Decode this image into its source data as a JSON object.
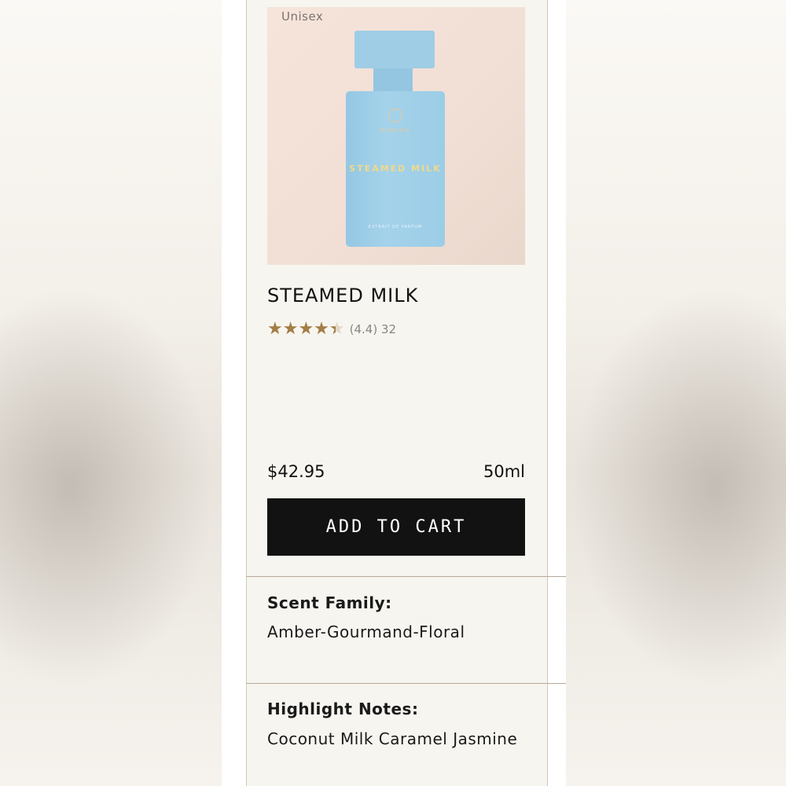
{
  "product": {
    "tag": "Unisex",
    "image": {
      "brand": "DAKCHA",
      "bottle_label": "STEAMED MILK",
      "bottle_sub": "EXTRAIT DE PARFUM"
    },
    "title": "STEAMED MILK",
    "rating": {
      "value": 4.4,
      "max": 5,
      "stars_glyph": "★★★★★",
      "text": "(4.4) 32"
    },
    "price": "$42.95",
    "size": "50ml",
    "add_to_cart_label": "ADD TO CART"
  },
  "details": {
    "scent_family_label": "Scent Family:",
    "scent_family_value": "Amber-Gourmand-Floral",
    "highlight_notes_label": "Highlight Notes:",
    "highlight_notes_value": "Coconut Milk Caramel Jasmine"
  },
  "colors": {
    "star_fill": "#a27d45",
    "button_bg": "#121212",
    "bottle_blue": "#9fcde5"
  }
}
